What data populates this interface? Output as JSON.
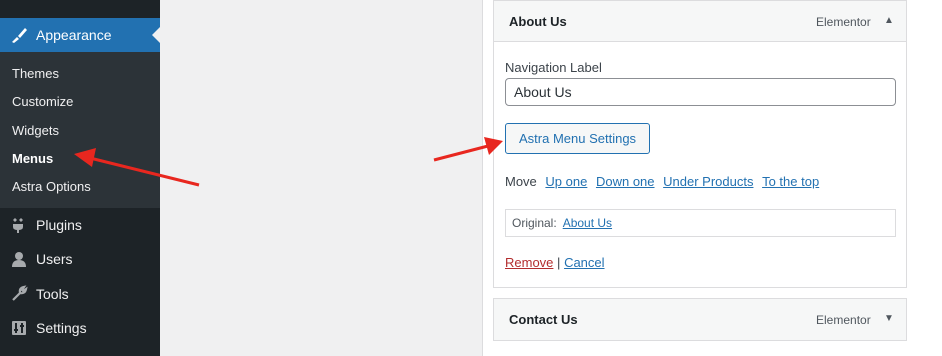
{
  "sidebar": {
    "appearance": {
      "label": "Appearance",
      "icon": "paintbrush-icon"
    },
    "submenu": [
      {
        "label": "Themes"
      },
      {
        "label": "Customize"
      },
      {
        "label": "Widgets"
      },
      {
        "label": "Menus"
      },
      {
        "label": "Astra Options"
      }
    ],
    "items": [
      {
        "label": "Plugins",
        "icon": "plugin-icon"
      },
      {
        "label": "Users",
        "icon": "user-icon"
      },
      {
        "label": "Tools",
        "icon": "wrench-icon"
      },
      {
        "label": "Settings",
        "icon": "settings-icon"
      }
    ]
  },
  "menu_item_about": {
    "title": "About Us",
    "type": "Elementor",
    "nav_label_caption": "Navigation Label",
    "nav_label_value": "About Us",
    "astra_button": "Astra Menu Settings",
    "move_label": "Move",
    "move_links": [
      "Up one",
      "Down one",
      "Under Products",
      "To the top"
    ],
    "original_label": "Original:",
    "original_link": "About Us",
    "remove": "Remove",
    "separator": "|",
    "cancel": "Cancel"
  },
  "menu_item_contact": {
    "title": "Contact Us",
    "type": "Elementor"
  },
  "colors": {
    "sidebar_bg": "#1d2327",
    "active_blue": "#2271b1",
    "annotation_red": "#e8271f"
  }
}
